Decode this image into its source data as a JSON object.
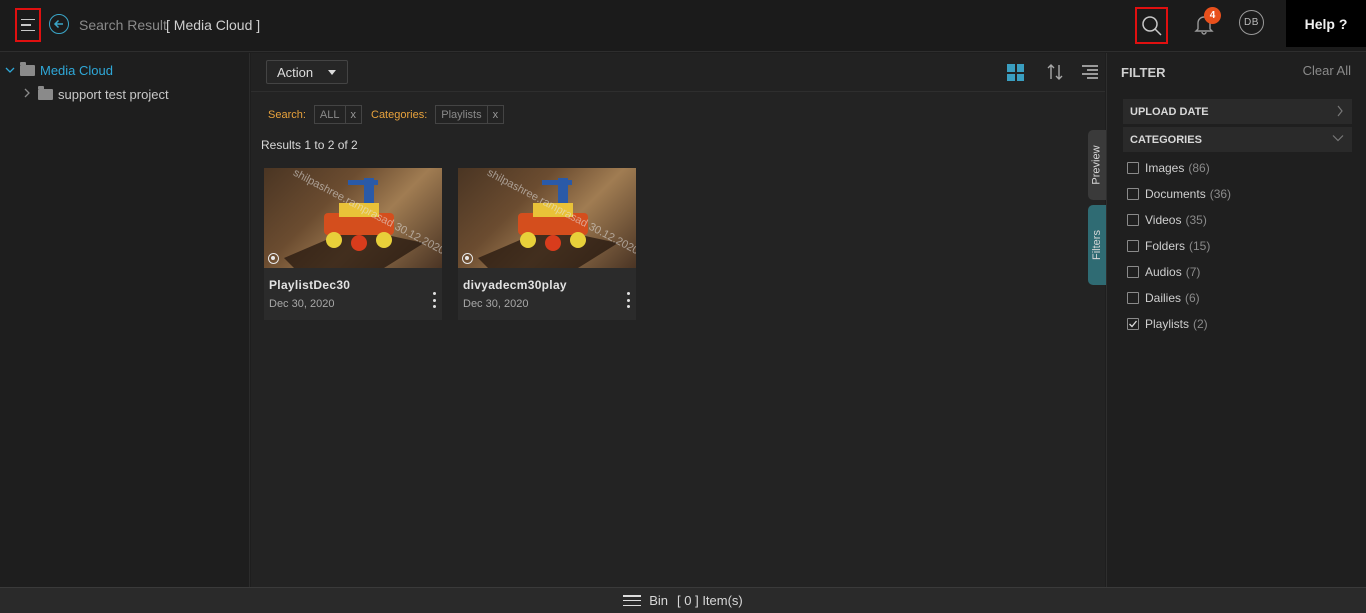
{
  "header": {
    "crumb": "Search Result",
    "crumb_sub": "[ Media Cloud ]",
    "notif_count": "4",
    "avatar_initials": "DB",
    "help_label": "Help ?"
  },
  "tree": {
    "root_label": "Media Cloud",
    "child_label": "support test project"
  },
  "toolbar": {
    "action_label": "Action"
  },
  "search_filters": {
    "search_label": "Search:",
    "search_value": "ALL",
    "categories_label": "Categories:",
    "categories_value": "Playlists",
    "remove_label": "x"
  },
  "results_text": "Results 1 to 2 of 2",
  "cards": [
    {
      "title": "PlaylistDec30",
      "date": "Dec 30, 2020",
      "watermark": "shilpashree.ramprasad 30.12.2020"
    },
    {
      "title": "divyadecm30play",
      "date": "Dec 30, 2020",
      "watermark": "shilpashree.ramprasad 30.12.2020"
    }
  ],
  "side_tabs": {
    "preview": "Preview",
    "filters": "Filters"
  },
  "filter_panel": {
    "title": "FILTER",
    "clear_all": "Clear All",
    "upload_date": "UPLOAD DATE",
    "categories": "CATEGORIES",
    "options": [
      {
        "label": "Images",
        "count": "(86)",
        "checked": false
      },
      {
        "label": "Documents",
        "count": "(36)",
        "checked": false
      },
      {
        "label": "Videos",
        "count": "(35)",
        "checked": false
      },
      {
        "label": "Folders",
        "count": "(15)",
        "checked": false
      },
      {
        "label": "Audios",
        "count": "(7)",
        "checked": false
      },
      {
        "label": "Dailies",
        "count": "(6)",
        "checked": false
      },
      {
        "label": "Playlists",
        "count": "(2)",
        "checked": true
      }
    ]
  },
  "bottom": {
    "bin_label": "Bin",
    "bin_count": "[ 0 ] Item(s)"
  },
  "colors": {
    "accent": "#2fa8d8",
    "highlight_box": "#e01010",
    "badge": "#e8501c",
    "filter_label": "#e8a23c"
  }
}
